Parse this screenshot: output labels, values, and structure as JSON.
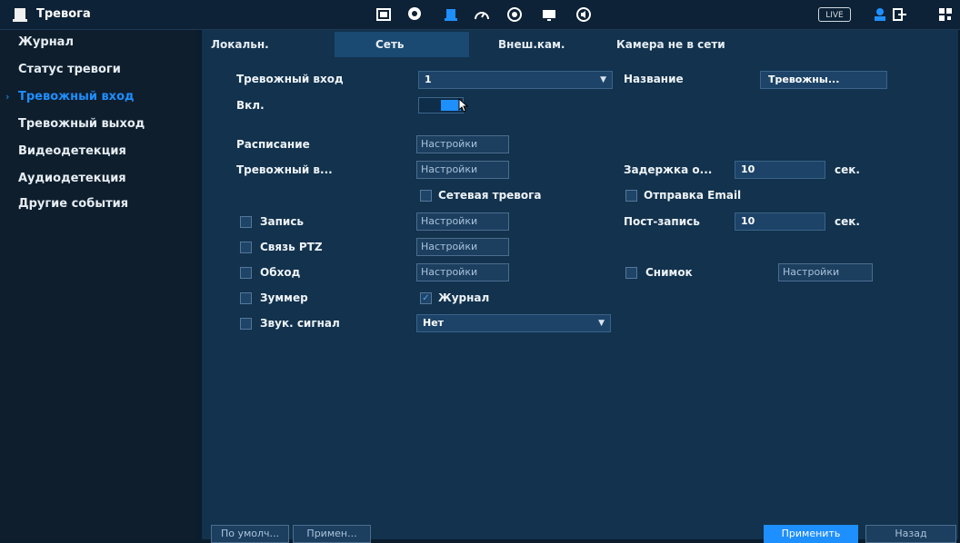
{
  "header": {
    "title": "Тревога",
    "live_label": "LIVE",
    "icons": [
      "alarm-bell-icon",
      "display-icon",
      "head-icon",
      "alarm-bell-active-icon",
      "speedometer-icon",
      "disc-icon",
      "monitor-icon",
      "audio-icon",
      "user-icon",
      "logout-icon",
      "qr-icon"
    ]
  },
  "sidebar": {
    "items": [
      {
        "label": "Журнал"
      },
      {
        "label": "Статус тревоги"
      },
      {
        "label": "Тревожный вход"
      },
      {
        "label": "Тревожный выход"
      },
      {
        "label": "Видеодетекция"
      },
      {
        "label": "Аудиодетекция"
      },
      {
        "label": "Другие события"
      }
    ],
    "active_index": 2
  },
  "tabs": [
    {
      "label": "Локальн."
    },
    {
      "label": "Сеть"
    },
    {
      "label": "Внеш.кам."
    },
    {
      "label": "Камера не в сети"
    }
  ],
  "form": {
    "alarm_input_label": "Тревожный вход",
    "alarm_input_value": "1",
    "name_label": "Название",
    "name_value": "Тревожны...",
    "enable_label": "Вкл.",
    "enable_on": true,
    "schedule_label": "Расписание",
    "alarm_out_label": "Тревожный в...",
    "delay_label": "Задержка о...",
    "delay_value": "10",
    "delay_unit": "сек.",
    "net_alarm_label": "Сетевая тревога",
    "net_alarm_checked": false,
    "email_label": "Отправка Email",
    "email_checked": false,
    "record_label": "Запись",
    "record_checked": false,
    "post_record_label": "Пост-запись",
    "post_record_value": "10",
    "post_record_unit": "сек.",
    "ptz_label": "Связь PTZ",
    "ptz_checked": false,
    "tour_label": "Обход",
    "tour_checked": false,
    "snapshot_label": "Снимок",
    "snapshot_checked": false,
    "buzzer_label": "Зуммер",
    "buzzer_checked": false,
    "log_label": "Журнал",
    "log_checked": true,
    "sound_label": "Звук. сигнал",
    "sound_value": "Нет",
    "settings_label": "Настройки"
  },
  "footer": {
    "default_label": "По умолч...",
    "apply_short_label": "Примен...",
    "apply_label": "Применить",
    "back_label": "Назад"
  },
  "colors": {
    "accent": "#1e8fff",
    "background": "#0b1c2c",
    "panel": "#12324d"
  }
}
